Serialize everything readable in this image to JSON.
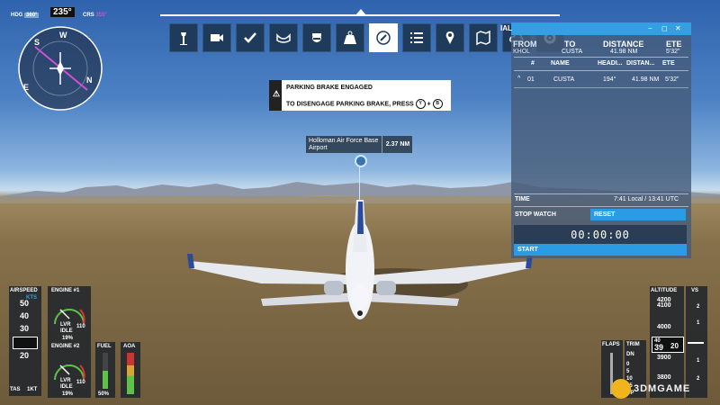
{
  "compass": {
    "hdg_label": "HDG",
    "hdg_value": "360°",
    "heading": "235°",
    "crs_label": "CRS",
    "crs_value": "355°",
    "marks": {
      "w": "W",
      "e": "E",
      "s": "S",
      "n": "N"
    }
  },
  "toolbar": {
    "icons": [
      "atc-tower-icon",
      "camera-icon",
      "checklist-icon",
      "assistance-icon",
      "pilot-icon",
      "weight-icon",
      "navlog-icon",
      "objectives-icon",
      "waypoint-icon",
      "map-icon",
      "weather-icon",
      "settings-icon"
    ],
    "active_index": 6
  },
  "notice": {
    "line1": "PARKING BRAKE ENGAGED",
    "line2": "TO DISENGAGE PARKING BRAKE, PRESS",
    "key1": "Y",
    "plus": "+",
    "key2": "B",
    "warn": "⚠"
  },
  "waypoint": {
    "name": "Holloman Air Force Base Airport",
    "distance": "2.37 NM"
  },
  "navlog": {
    "header_title": "IAL",
    "header_btns": [
      "−",
      "◻",
      "✕"
    ],
    "summary_from": "FROM",
    "summary_from_val": "KHOL",
    "summary_to": "TO",
    "summary_to_val": "CUSTA",
    "summary_dist": "DISTANCE",
    "summary_dist_val": "41.98 NM",
    "summary_ete": "ETE",
    "summary_ete_val": "5'32\"",
    "columns": [
      "#",
      "NAME",
      "HEADI...",
      "DISTAN...",
      "ETE"
    ],
    "rows": [
      {
        "toggle": "^",
        "num": "01",
        "name": "CUSTA",
        "heading": "194°",
        "distance": "41.98 NM",
        "ete": "5'32\""
      }
    ],
    "time_label": "TIME",
    "time_local": "7:41 Local",
    "time_sep": "/",
    "time_utc": "13:41 UTC",
    "stopwatch_label": "STOP WATCH",
    "reset": "RESET",
    "stopwatch": "00:00:00",
    "start": "START"
  },
  "instruments": {
    "airspeed": "AIRSPEED",
    "kts": "KTS",
    "as_ticks": [
      "50",
      "40",
      "30",
      "20"
    ],
    "tas": "TAS",
    "tas_val": "1KT",
    "engine1": "ENGINE #1",
    "engine2": "ENGINE #2",
    "lvr": "LVR",
    "idle": "IDLE",
    "e_val": "110",
    "e_pct": "19%",
    "fuel": "FUEL",
    "fuel_pct": "50%",
    "aoa": "AOA",
    "flaps": "FLAPS",
    "trim": "TRIM",
    "up": "UP",
    "dn": "DN",
    "trim_vals": [
      "0",
      "5",
      "10",
      "15"
    ],
    "altitude": "ALTITUDE",
    "alt_ticks": [
      "4200",
      "4100",
      "4000",
      "3900",
      "3800"
    ],
    "alt_cur": "39",
    "alt_sub": "20",
    "alt_top": "40",
    "vs": "VS",
    "vs_ticks": [
      "2",
      "1",
      "1",
      "2"
    ]
  },
  "watermark": "3DMGAME",
  "colors": {
    "accent": "#34a0e3",
    "panel": "#465c7a",
    "toolbar": "#1f3b5c"
  }
}
